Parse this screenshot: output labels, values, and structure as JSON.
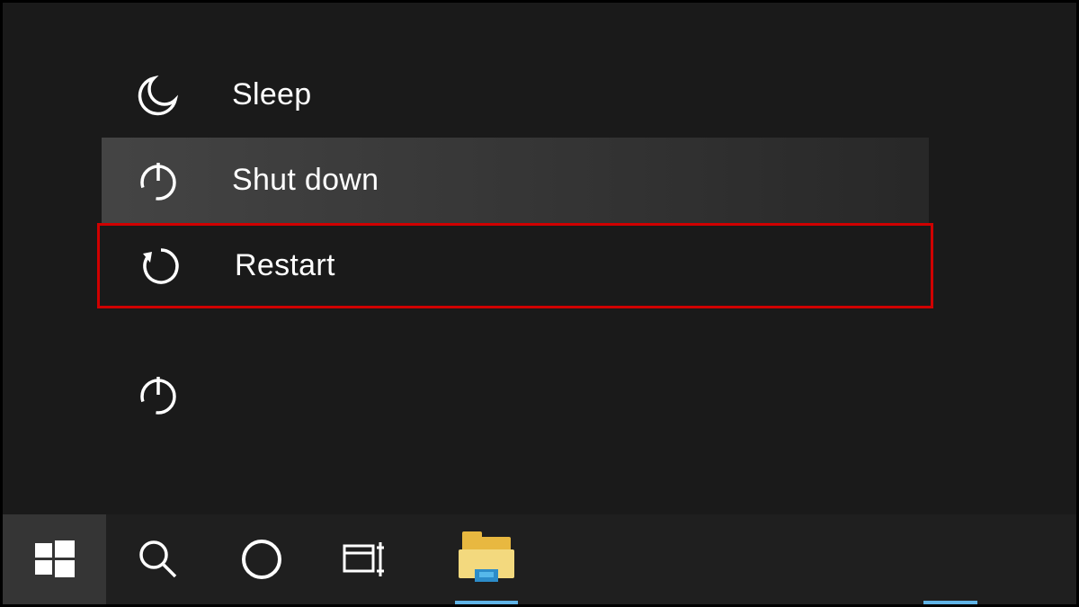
{
  "power_menu": {
    "items": [
      {
        "icon": "moon-icon",
        "label": "Sleep",
        "hovered": false,
        "highlighted": false
      },
      {
        "icon": "power-icon",
        "label": "Shut down",
        "hovered": true,
        "highlighted": false
      },
      {
        "icon": "restart-icon",
        "label": "Restart",
        "hovered": false,
        "highlighted": true
      }
    ]
  },
  "taskbar": {
    "start": {
      "icon": "windows-icon"
    },
    "search": {
      "icon": "search-icon"
    },
    "cortana": {
      "icon": "cortana-icon"
    },
    "taskview": {
      "icon": "taskview-icon"
    },
    "file_explorer": {
      "icon": "file-explorer-icon",
      "running": true
    }
  }
}
